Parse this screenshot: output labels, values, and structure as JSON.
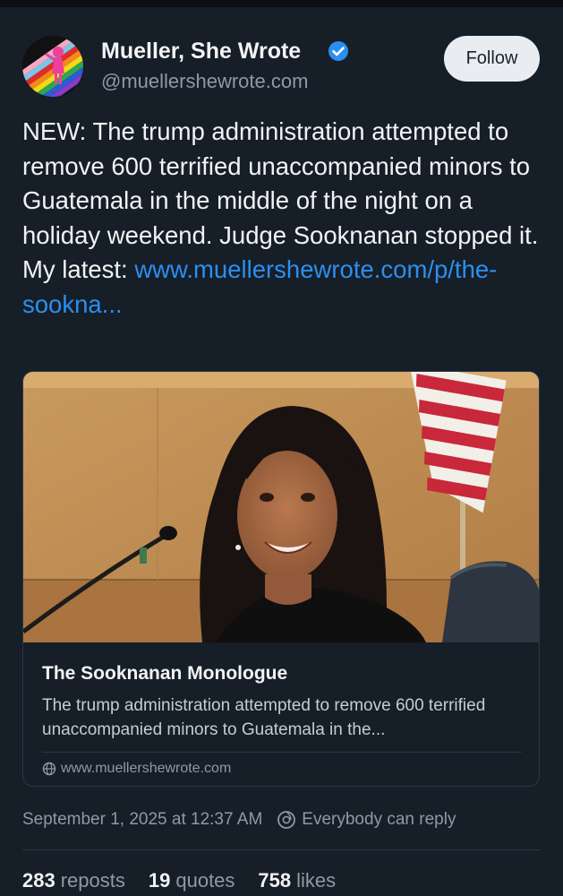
{
  "author": {
    "display_name": "Mueller, She Wrote",
    "handle": "@muellershewrote.com",
    "verified": true
  },
  "follow_label": "Follow",
  "post": {
    "text": "NEW: The trump administration attempted to remove 600 terrified unaccompanied minors to Guatemala in the middle of the night on a holiday weekend. Judge Sooknanan stopped it. My latest: ",
    "link_text": "www.muellershewrote.com/p/the-sookna..."
  },
  "card": {
    "title": "The Sooknanan Monologue",
    "description": "The trump administration attempted to remove 600 terrified unaccompanied minors to Guatemala in the...",
    "domain": "www.muellershewrote.com"
  },
  "meta": {
    "timestamp": "September 1, 2025 at 12:37 AM",
    "reply_setting": "Everybody can reply"
  },
  "stats": {
    "reposts_count": "283",
    "reposts_label": "reposts",
    "quotes_count": "19",
    "quotes_label": "quotes",
    "likes_count": "758",
    "likes_label": "likes"
  },
  "colors": {
    "background": "#161e27",
    "link": "#2b8ff0",
    "verified": "#2b8ff0",
    "muted": "#8d9aa8"
  }
}
